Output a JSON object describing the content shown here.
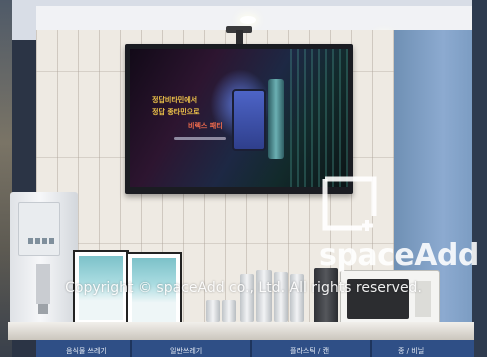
{
  "scene": {
    "description_colors": {
      "tile_wall": "#eeeae3",
      "blue_wall": "#8caad0",
      "cabinet": "#2f4f86",
      "tv_bezel": "#1a1c22"
    }
  },
  "tv_screen": {
    "headline_line1": "정답비타민에서",
    "headline_line2": "정답 종타민으로",
    "headline_line3": "비렉스 패티",
    "icons": [
      "phone-image-icon",
      "bottle-image-icon"
    ]
  },
  "watermark": {
    "brand": "spaceAdd",
    "copyright": "Copyright © spaceAdd co., Ltd. All rights reserved.",
    "icons": [
      "square-corner-logo-icon"
    ]
  },
  "cabinet_labels": [
    "음식물 쓰레기",
    "일반쓰레기",
    "플라스틱 / 캔",
    "종 / 비닐"
  ]
}
